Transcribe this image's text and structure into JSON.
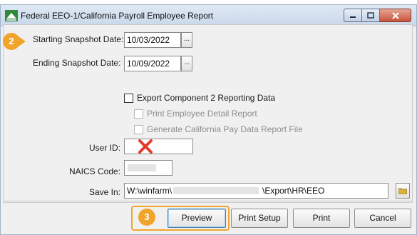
{
  "window": {
    "title": "Federal EEO-1/California Payroll Employee Report"
  },
  "form": {
    "start_date_label": "Starting Snapshot Date:",
    "start_date_value": "10/03/2022",
    "end_date_label": "Ending Snapshot Date:",
    "end_date_value": "10/09/2022",
    "browse_label": "...",
    "export_component2_label": "Export Component 2 Reporting Data",
    "print_detail_label": "Print Employee Detail Report",
    "generate_ca_label": "Generate California Pay Data Report File",
    "user_id_label": "User ID:",
    "naics_label": "NAICS Code:",
    "save_in_label": "Save In:",
    "save_in_prefix": "W:\\winfarm\\",
    "save_in_suffix": "\\Export\\HR\\EEO"
  },
  "buttons": {
    "preview": "Preview",
    "print_setup": "Print Setup",
    "print": "Print",
    "cancel": "Cancel"
  },
  "callouts": {
    "step2": "2",
    "step3": "3"
  },
  "colors": {
    "callout": "#f0a52a",
    "mark_x": "#e23b2e"
  }
}
